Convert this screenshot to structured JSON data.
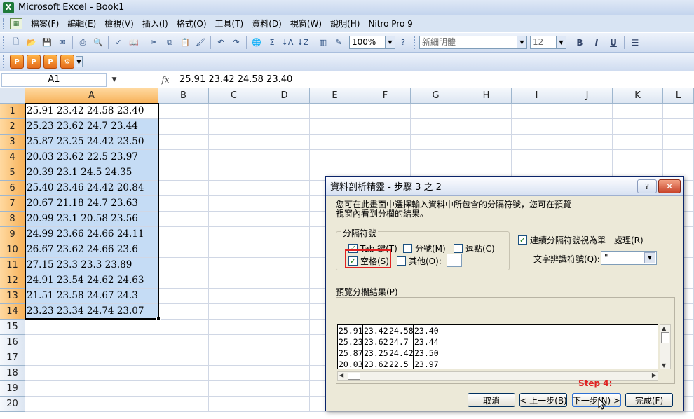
{
  "window": {
    "title": "Microsoft Excel - Book1"
  },
  "menu": [
    "檔案(F)",
    "編輯(E)",
    "檢視(V)",
    "插入(I)",
    "格式(O)",
    "工具(T)",
    "資料(D)",
    "視窗(W)",
    "說明(H)",
    "Nitro Pro 9"
  ],
  "toolbar": {
    "zoom": "100%",
    "font": "新細明體",
    "size": "12"
  },
  "formula": {
    "name_box": "A1",
    "fx": "fx",
    "content": "25.91 23.42 24.58 23.40"
  },
  "columns": [
    "A",
    "B",
    "C",
    "D",
    "E",
    "F",
    "G",
    "H",
    "I",
    "J",
    "K",
    "L"
  ],
  "rows": [
    "1",
    "2",
    "3",
    "4",
    "5",
    "6",
    "7",
    "8",
    "9",
    "10",
    "11",
    "12",
    "13",
    "14",
    "15",
    "16",
    "17",
    "18",
    "19",
    "20"
  ],
  "cells_a": [
    "25.91 23.42 24.58 23.40",
    "25.23 23.62 24.7 23.44",
    "25.87 23.25 24.42 23.50",
    "20.03 23.62 22.5 23.97",
    "20.39 23.1 24.5 24.35",
    "25.40 23.46 24.42 20.84",
    "20.67 21.18 24.7 23.63",
    "20.99 23.1 20.58 23.56",
    "24.99 23.66 24.66 24.11",
    "26.67 23.62 24.66 23.6",
    "27.15 23.3 23.3 23.89",
    "24.91 23.54 24.62 24.63",
    "21.51 23.58 24.67 24.3",
    "23.23 23.34 24.74 23.07"
  ],
  "dialog": {
    "title": "資料剖析精靈 - 步驟 3 之 2",
    "help": "?",
    "close": "✕",
    "description_line1": "您可在此畫面中選擇輸入資料中所包含的分隔符號，您可在預覽",
    "description_line2": "視窗內看到分欄的結果。",
    "delimiters_label": "分隔符號",
    "tab": "Tab 鍵(T)",
    "semicolon": "分號(M)",
    "comma": "逗點(C)",
    "space": "空格(S)",
    "other": "其他(O):",
    "consecutive": "連續分隔符號視為單一處理(R)",
    "qualifier_label": "文字辨識符號(Q):",
    "qualifier_value": "\"",
    "preview_label": "預覽分欄結果(P)",
    "preview_rows": [
      [
        "25.91",
        "23.42",
        "24.58",
        "23.40"
      ],
      [
        "25.23",
        "23.62",
        "24.7",
        "23.44"
      ],
      [
        "25.87",
        "23.25",
        "24.42",
        "23.50"
      ],
      [
        "20.03",
        "23.62",
        "22.5",
        "23.97"
      ]
    ],
    "step_note": "Step 4:",
    "buttons": {
      "cancel": "取消",
      "back": "< 上一步(B)",
      "next": "下一步(N) >",
      "finish": "完成(F)"
    }
  }
}
